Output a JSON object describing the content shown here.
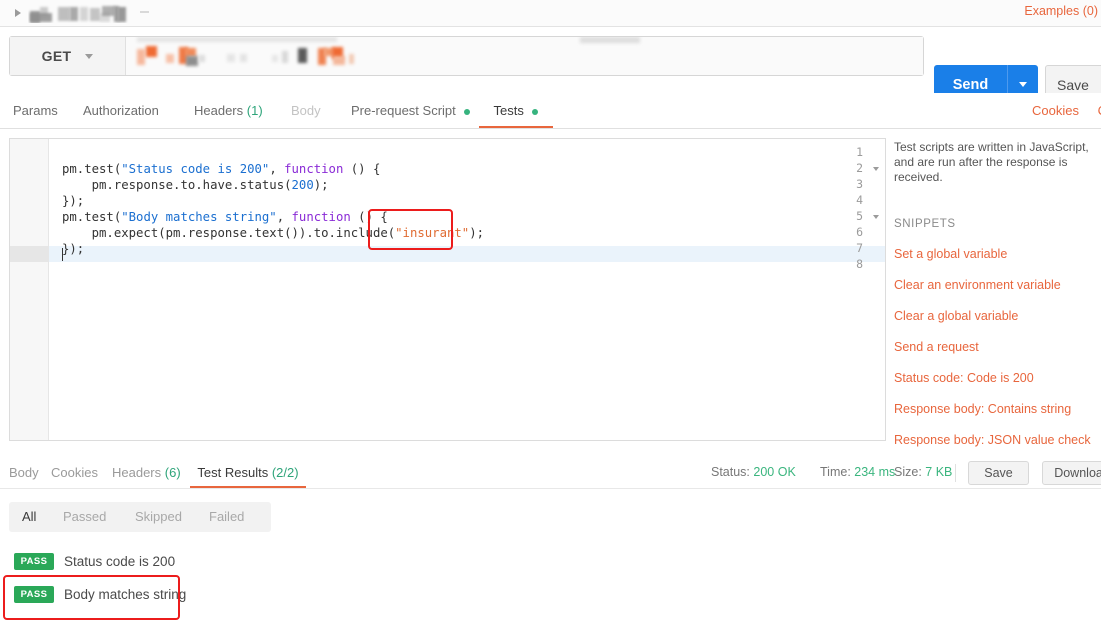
{
  "tabstrip": {
    "tab_name_redacted": "",
    "examples_link": "Examples (0)"
  },
  "request_bar": {
    "method": "GET",
    "url_redacted": "",
    "send_label": "Send",
    "save_label": "Save"
  },
  "request_tabs": {
    "items": [
      {
        "label": "Params",
        "count": "",
        "dot": false,
        "dim": false,
        "active": false
      },
      {
        "label": "Authorization",
        "count": "",
        "dot": false,
        "dim": false,
        "active": false
      },
      {
        "label": "Headers",
        "count": "(1)",
        "dot": false,
        "dim": false,
        "active": false
      },
      {
        "label": "Body",
        "count": "",
        "dot": false,
        "dim": true,
        "active": false
      },
      {
        "label": "Pre-request Script",
        "count": "",
        "dot": true,
        "dim": false,
        "active": false
      },
      {
        "label": "Tests",
        "count": "",
        "dot": true,
        "dim": false,
        "active": true
      }
    ],
    "cookies_label": "Cookies",
    "code_label": "C"
  },
  "editor": {
    "lines": [
      {
        "n": "1",
        "fold": false,
        "text": ""
      },
      {
        "n": "2",
        "fold": true,
        "text": "pm.test(\"Status code is 200\", function () {"
      },
      {
        "n": "3",
        "fold": false,
        "text": "    pm.response.to.have.status(200);"
      },
      {
        "n": "4",
        "fold": false,
        "text": "});"
      },
      {
        "n": "5",
        "fold": true,
        "text": "pm.test(\"Body matches string\", function () {"
      },
      {
        "n": "6",
        "fold": false,
        "text": "    pm.expect(pm.response.text()).to.include(\"insurant\");"
      },
      {
        "n": "7",
        "fold": false,
        "text": "});"
      },
      {
        "n": "8",
        "fold": false,
        "text": ""
      }
    ],
    "active_line": 8,
    "tokens": {
      "str_status": "\"Status code is 200\"",
      "kw_function": "function",
      "num_200": "200",
      "str_body": "\"Body matches string\"",
      "str_insurant": "\"insurant\""
    }
  },
  "snippets": {
    "description": "Test scripts are written in JavaScript, and are run after the response is received.",
    "heading": "SNIPPETS",
    "items": [
      "Set a global variable",
      "Clear an environment variable",
      "Clear a global variable",
      "Send a request",
      "Status code: Code is 200",
      "Response body: Contains string",
      "Response body: JSON value check"
    ]
  },
  "response": {
    "tabs": [
      {
        "label": "Body",
        "count": "",
        "active": false
      },
      {
        "label": "Cookies",
        "count": "",
        "active": false
      },
      {
        "label": "Headers",
        "count": "(6)",
        "active": false
      },
      {
        "label": "Test Results",
        "count": "(2/2)",
        "active": true
      }
    ],
    "meta": {
      "status_label": "Status:",
      "status_value": "200 OK",
      "time_label": "Time:",
      "time_value": "234 ms",
      "size_label": "Size:",
      "size_value": "7 KB"
    },
    "save_label": "Save",
    "download_label": "Download"
  },
  "result_filters": {
    "items": [
      "All",
      "Passed",
      "Skipped",
      "Failed"
    ],
    "active": "All"
  },
  "test_results": [
    {
      "status": "PASS",
      "name": "Status code is 200",
      "highlighted": false
    },
    {
      "status": "PASS",
      "name": "Body matches string",
      "highlighted": true
    }
  ],
  "colors": {
    "accent_orange": "#e8663d",
    "send_blue": "#1a7fe8",
    "pass_green": "#2aa858",
    "dot_green": "#36b37e",
    "annotation_red": "#ec1c1c"
  }
}
